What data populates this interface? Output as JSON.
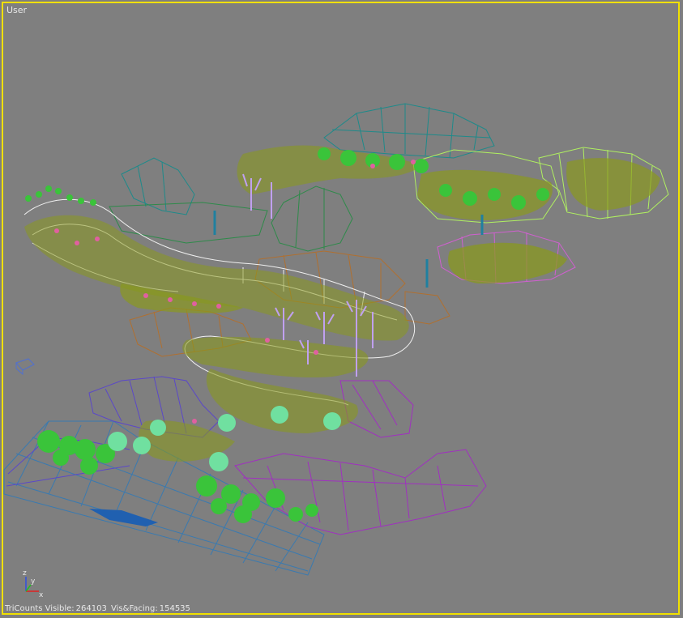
{
  "viewport": {
    "label": "User",
    "border_color": "#f0e000",
    "background_color": "#7f7f7f"
  },
  "status": {
    "tricount_label": "TriCounts Visible:",
    "tricount_value": "264103",
    "facing_label": "Vis&Facing:",
    "facing_value": "154535"
  },
  "axis_gizmo": {
    "x": "x",
    "y": "y",
    "z": "z"
  },
  "colors": {
    "foliage": "#8a9a1a",
    "foliage_bright": "#3ac43a",
    "path_white": "#f0f0f0",
    "mesh_teal": "#1e8a8a",
    "mesh_magenta": "#a030c0",
    "mesh_orange": "#b07030",
    "mesh_blue": "#5040c0",
    "mesh_lime": "#a0e040",
    "flower_pink": "#e060a0"
  }
}
